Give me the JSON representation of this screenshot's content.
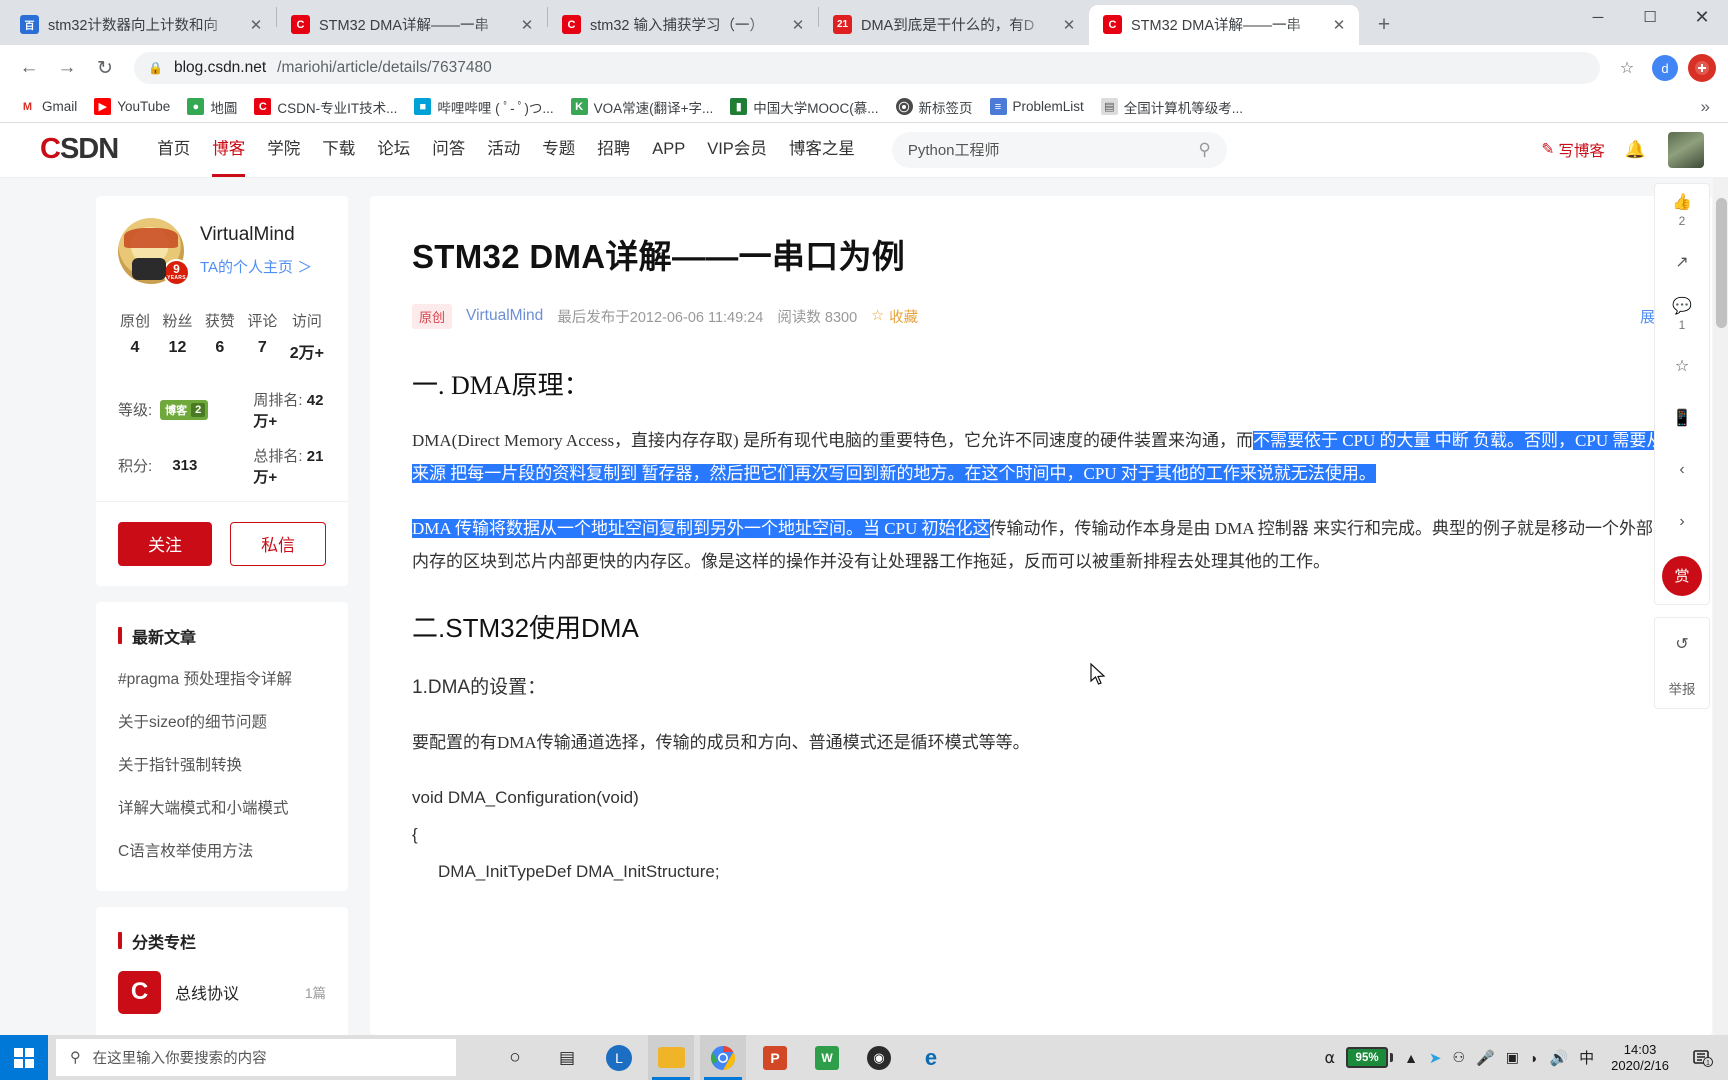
{
  "browser": {
    "tabs": [
      {
        "title": "stm32计数器向上计数和向",
        "favicon": "baidu-icon",
        "favicon_char": "百",
        "favicon_bg": "#2b6fd6",
        "active": false
      },
      {
        "title": "STM32 DMA详解——一串",
        "favicon": "csdn-icon",
        "favicon_char": "C",
        "favicon_bg": "#e60012",
        "active": false
      },
      {
        "title": "stm32 输入捕获学习（一）",
        "favicon": "csdn-icon",
        "favicon_char": "C",
        "favicon_bg": "#e60012",
        "active": false
      },
      {
        "title": "DMA到底是干什么的，有D",
        "favicon": "21ic-icon",
        "favicon_char": "21",
        "favicon_bg": "#e02020",
        "active": false
      },
      {
        "title": "STM32 DMA详解——一串",
        "favicon": "csdn-icon",
        "favicon_char": "C",
        "favicon_bg": "#e60012",
        "active": true
      }
    ],
    "new_tab_label": "+",
    "window_controls": {
      "minimize": "─",
      "maximize": "☐",
      "close": "✕"
    },
    "nav": {
      "back": "←",
      "forward": "→",
      "reload": "↻"
    },
    "omnibox": {
      "lock_icon": "lock-icon",
      "host": "blog.csdn.net",
      "path": "/mariohi/article/details/7637480",
      "star_icon": "star-icon"
    },
    "profile_initial": "d",
    "bookmarks": [
      {
        "label": "Gmail",
        "icon": "gmail-icon",
        "char": "M",
        "bg": "#ffffff",
        "fg": "#d93025"
      },
      {
        "label": "YouTube",
        "icon": "youtube-icon",
        "char": "▶",
        "bg": "#ff0000",
        "fg": "#ffffff"
      },
      {
        "label": "地圖",
        "icon": "maps-icon",
        "char": "◆",
        "bg": "#34a853",
        "fg": "#ffffff"
      },
      {
        "label": "CSDN-专业IT技术...",
        "icon": "csdn-icon",
        "char": "C",
        "bg": "#e60012",
        "fg": "#ffffff"
      },
      {
        "label": "哔哩哔哩 ( ﾟ- ﾟ)つ...",
        "icon": "bilibili-icon",
        "char": "■",
        "bg": "#00a1d6",
        "fg": "#ffffff"
      },
      {
        "label": "VOA常速(翻译+字...",
        "icon": "kiwi-icon",
        "char": "K",
        "bg": "#3aa757",
        "fg": "#ffffff"
      },
      {
        "label": "中国大学MOOC(慕...",
        "icon": "mooc-icon",
        "char": "▰",
        "bg": "#1e7e34",
        "fg": "#ffffff"
      },
      {
        "label": "新标签页",
        "icon": "globe-icon",
        "char": "⊕",
        "bg": "#4a4a4a",
        "fg": "#ffffff"
      },
      {
        "label": "ProblemList",
        "icon": "problemlist-icon",
        "char": "≡",
        "bg": "#4b7bd6",
        "fg": "#ffffff"
      },
      {
        "label": "全国计算机等级考...",
        "icon": "doc-icon",
        "char": "▤",
        "bg": "#dcdcdc",
        "fg": "#555555"
      }
    ],
    "bookmarks_more": "»"
  },
  "site": {
    "logo_c": "C",
    "logo_rest": "SDN",
    "nav": [
      {
        "label": "首页",
        "active": false
      },
      {
        "label": "博客",
        "active": true
      },
      {
        "label": "学院",
        "active": false
      },
      {
        "label": "下载",
        "active": false
      },
      {
        "label": "论坛",
        "active": false
      },
      {
        "label": "问答",
        "active": false
      },
      {
        "label": "活动",
        "active": false
      },
      {
        "label": "专题",
        "active": false
      },
      {
        "label": "招聘",
        "active": false
      },
      {
        "label": "APP",
        "active": false
      },
      {
        "label": "VIP会员",
        "active": false
      },
      {
        "label": "博客之星",
        "active": false
      }
    ],
    "search": {
      "value": "Python工程师",
      "placeholder": "搜索",
      "icon": "search-icon"
    },
    "write_blog": "写博客",
    "write_icon": "pen-icon",
    "bell_icon": "bell-icon"
  },
  "profile": {
    "name": "VirtualMind",
    "homepage_link": "TA的个人主页 ＞",
    "badge_years": "9",
    "badge_years_label": "YEARS",
    "stats": [
      {
        "label": "原创",
        "value": "4"
      },
      {
        "label": "粉丝",
        "value": "12"
      },
      {
        "label": "获赞",
        "value": "6"
      },
      {
        "label": "评论",
        "value": "7"
      },
      {
        "label": "访问",
        "value": "2万+"
      }
    ],
    "level_label": "等级:",
    "level_badge_text": "博客",
    "level_badge_num": "2",
    "week_rank_label": "周排名:",
    "week_rank_value": "42万+",
    "points_label": "积分:",
    "points_value": "313",
    "total_rank_label": "总排名:",
    "total_rank_value": "21万+",
    "follow_button": "关注",
    "message_button": "私信"
  },
  "latest": {
    "title": "最新文章",
    "items": [
      "#pragma 预处理指令详解",
      "关于sizeof的细节问题",
      "关于指针强制转换",
      "详解大端模式和小端模式",
      "C语言枚举使用方法"
    ]
  },
  "columns": {
    "title": "分类专栏",
    "items": [
      {
        "name": "总线协议",
        "count": "1篇",
        "icon_char": "C"
      }
    ]
  },
  "article": {
    "title": "STM32 DMA详解——一串口为例",
    "tag": "原创",
    "author": "VirtualMind",
    "published": "最后发布于2012-06-06 11:49:24",
    "reads": "阅读数 8300",
    "favorite": "收藏",
    "favorite_icon": "star-icon",
    "expand": "展开",
    "h2_1": "一. DMA原理：",
    "p1_plain": "DMA(Direct Memory Access，直接内存存取) 是所有现代电脑的重要特色，它允许不同速度的硬件装置来沟通，而",
    "p1_hl": "不需要依于 CPU 的大量 中断 负载。否则，CPU 需要从 来源 把每一片段的资料复制到 暂存器，然后把它们再次写回到新的地方。在这个时间中，CPU 对于其他的工作来说就无法使用。",
    "p2_hl": "DMA 传输将数据从一个地址空间复制到另外一个地址空间。当 CPU 初始化这",
    "p2_plain": "传输动作，传输动作本身是由 DMA 控制器 来实行和完成。典型的例子就是移动一个外部内存的区块到芯片内部更快的内存区。像是这样的操作并没有让处理器工作拖延，反而可以被重新排程去处理其他的工作。",
    "h2_2": "二.STM32使用DMA",
    "h3_1": "1.DMA的设置：",
    "p3": "要配置的有DMA传输通道选择，传输的成员和方向、普通模式还是循环模式等等。",
    "code1": "void DMA_Configuration(void)",
    "code2": "{",
    "code3": "DMA_InitTypeDef DMA_InitStructure;"
  },
  "rail": {
    "like_icon": "thumbs-up-icon",
    "like_count": "2",
    "share_icon": "share-icon",
    "comment_icon": "comment-icon",
    "comment_count": "1",
    "collect_icon": "star-outline-icon",
    "mobile_icon": "mobile-icon",
    "prev_icon": "chevron-left-icon",
    "next_icon": "chevron-right-icon",
    "reward_icon": "reward-icon",
    "reward_char": "赏",
    "back_icon": "undo-icon",
    "report_label": "举报"
  },
  "taskbar": {
    "start_icon": "windows-icon",
    "search_placeholder": "在这里输入你要搜索的内容",
    "search_icon": "search-icon",
    "apps": [
      {
        "name": "cortana-icon",
        "char": "○",
        "bg": "transparent",
        "fg": "#222222",
        "active": false
      },
      {
        "name": "taskview-icon",
        "char": "▤",
        "bg": "transparent",
        "fg": "#222222",
        "active": false
      },
      {
        "name": "app-l-icon",
        "char": "L",
        "bg": "#1b6ec2",
        "fg": "#ffffff",
        "active": false
      },
      {
        "name": "file-explorer-icon",
        "char": "▬",
        "bg": "#f0b429",
        "fg": "#ffffff",
        "active": true
      },
      {
        "name": "chrome-icon",
        "char": "●",
        "bg": "#ffffff",
        "fg": "#4285f4",
        "active": true
      },
      {
        "name": "powerpoint-icon",
        "char": "P",
        "bg": "#d24726",
        "fg": "#ffffff",
        "active": false
      },
      {
        "name": "wps-icon",
        "char": "W",
        "bg": "#2e9e4a",
        "fg": "#ffffff",
        "active": false
      },
      {
        "name": "obs-icon",
        "char": "◉",
        "bg": "#2b2b2b",
        "fg": "#ffffff",
        "active": false
      },
      {
        "name": "edge-icon",
        "char": "e",
        "bg": "#ffffff",
        "fg": "#0a6cb4",
        "active": false
      }
    ],
    "plug_icon": "plug-icon",
    "battery_percent": "95%",
    "chevron_icon": "chevron-up-icon",
    "tray_icons": [
      "cursor-icon",
      "usb-icon",
      "mic-icon",
      "screenshot-icon",
      "wifi-icon",
      "volume-icon"
    ],
    "ime": "中",
    "time": "14:03",
    "date": "2020/2/16",
    "notification_icon": "notification-icon",
    "notification_count": "1"
  },
  "colors": {
    "brand_red": "#ca0c16",
    "highlight_blue": "#2979ff",
    "link_blue": "#4f8ef7",
    "taskbar_bg": "#dfdfdf",
    "tabstrip_bg": "#dee1e6"
  }
}
